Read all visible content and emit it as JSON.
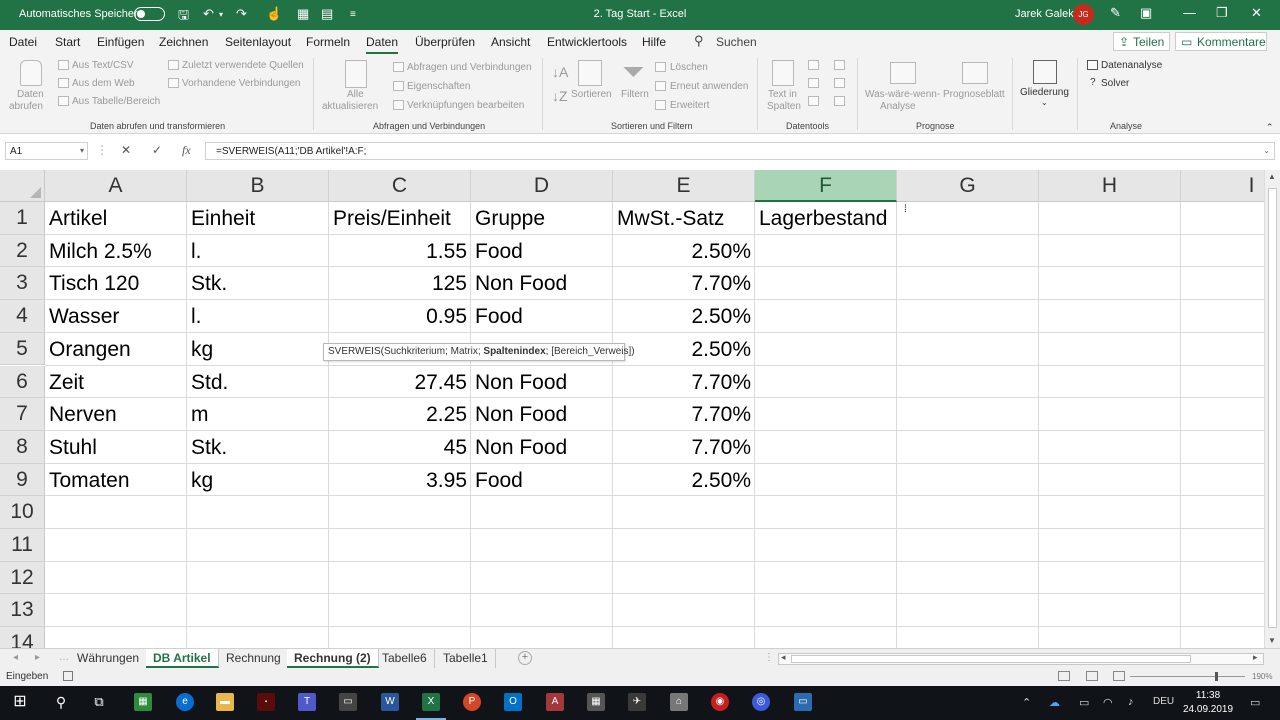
{
  "titlebar": {
    "autosave_label": "Automatisches Speichern",
    "title": "2. Tag Start  -  Excel",
    "user_name": "Jarek Galek",
    "user_initials": "JG"
  },
  "menu": {
    "tabs": [
      "Datei",
      "Start",
      "Einfügen",
      "Zeichnen",
      "Seitenlayout",
      "Formeln",
      "Daten",
      "Überprüfen",
      "Ansicht",
      "Entwicklertools",
      "Hilfe"
    ],
    "active_tab": "Daten",
    "search_label": "Suchen",
    "share_label": "Teilen",
    "comments_label": "Kommentare"
  },
  "ribbon": {
    "data_get": {
      "big_label_1": "Daten",
      "big_label_2": "abrufen",
      "items": [
        "Aus Text/CSV",
        "Aus dem Web",
        "Aus Tabelle/Bereich",
        "Zuletzt verwendete Quellen",
        "Vorhandene Verbindungen"
      ],
      "group": "Daten abrufen und transformieren"
    },
    "queries": {
      "big_label_1": "Alle",
      "big_label_2": "aktualisieren",
      "items": [
        "Abfragen und Verbindungen",
        "Eigenschaften",
        "Verknüpfungen bearbeiten"
      ],
      "group": "Abfragen und Verbindungen"
    },
    "sort": {
      "sort_label": "Sortieren",
      "filter_label": "Filtern",
      "items": [
        "Löschen",
        "Erneut anwenden",
        "Erweitert"
      ],
      "group": "Sortieren und Filtern"
    },
    "tools": {
      "big_label_1": "Text in",
      "big_label_2": "Spalten",
      "group": "Datentools"
    },
    "forecast": {
      "whatif_1": "Was-wäre-wenn-",
      "whatif_2": "Analyse",
      "sheet_label": "Prognoseblatt",
      "group": "Prognose"
    },
    "outline": {
      "label": "Gliederung"
    },
    "analysis": {
      "items": [
        "Datenanalyse",
        "Solver"
      ],
      "group": "Analyse"
    }
  },
  "formula_bar": {
    "name_box": "A1",
    "cancel_glyph": "✕",
    "enter_glyph": "✓",
    "fx_glyph": "fx",
    "formula": "=SVERWEIS(A11;'DB Artikel'!A:F;"
  },
  "sheet": {
    "columns": [
      "A",
      "B",
      "C",
      "D",
      "E",
      "F",
      "G",
      "H",
      "I"
    ],
    "selected_column": "F",
    "row_numbers": [
      "1",
      "2",
      "3",
      "4",
      "5",
      "6",
      "7",
      "8",
      "9",
      "10",
      "11",
      "12",
      "13",
      "14"
    ],
    "rows": [
      [
        "Artikel",
        "Einheit",
        "Preis/Einheit",
        "Gruppe",
        "MwSt.-Satz",
        "Lagerbestand"
      ],
      [
        "Milch 2.5%",
        "l.",
        "1.55",
        "Food",
        "2.50%",
        ""
      ],
      [
        "Tisch 120",
        "Stk.",
        "125",
        "Non Food",
        "7.70%",
        ""
      ],
      [
        "Wasser",
        "l.",
        "0.95",
        "Food",
        "2.50%",
        ""
      ],
      [
        "Orangen",
        "kg",
        "",
        "",
        "2.50%",
        ""
      ],
      [
        "Zeit",
        "Std.",
        "27.45",
        "Non Food",
        "7.70%",
        ""
      ],
      [
        "Nerven",
        "m",
        "2.25",
        "Non Food",
        "7.70%",
        ""
      ],
      [
        "Stuhl",
        "Stk.",
        "45",
        "Non Food",
        "7.70%",
        ""
      ],
      [
        "Tomaten",
        "kg",
        "3.95",
        "Food",
        "2.50%",
        ""
      ]
    ],
    "tooltip": {
      "prefix": "SVERWEIS(Suchkriterium; Matrix; ",
      "bold": "Spaltenindex",
      "suffix": "; [Bereich_Verweis])"
    }
  },
  "sheet_tabs": [
    "Währungen",
    "DB Artikel",
    "Rechnung",
    "Rechnung (2)",
    "Tabelle6",
    "Tabelle1"
  ],
  "status": {
    "mode": "Eingeben",
    "zoom": "190%"
  },
  "taskbar": {
    "lang": "DEU",
    "time": "11:38",
    "date": "24.09.2019"
  },
  "colors": {
    "excel_green": "#217346",
    "selected_header": "#a9d4b6"
  }
}
